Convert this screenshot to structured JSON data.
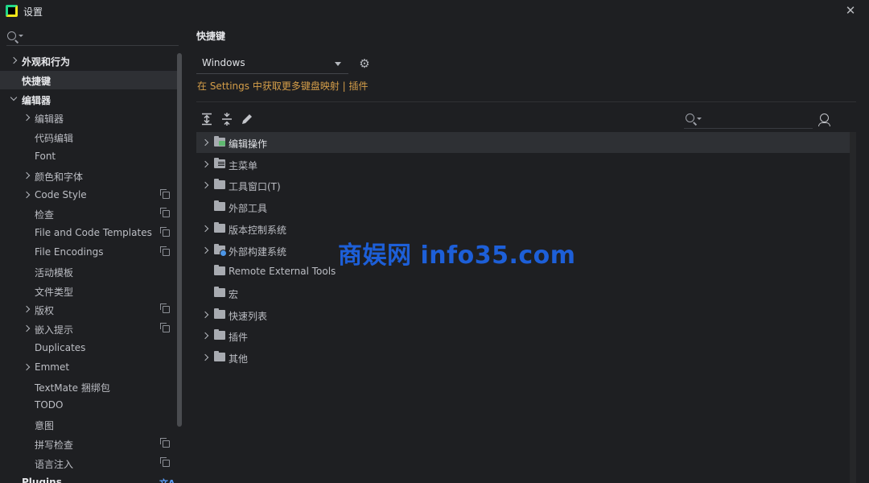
{
  "window": {
    "title": "设置",
    "close_symbol": "✕"
  },
  "sidebar": {
    "search_placeholder": "",
    "items": [
      {
        "label": "外观和行为",
        "level": 0,
        "chevron": "right"
      },
      {
        "label": "快捷键",
        "level": 0,
        "selected": true
      },
      {
        "label": "编辑器",
        "level": 0,
        "chevron": "down"
      },
      {
        "label": "编辑器",
        "level": 1,
        "chevron": "right"
      },
      {
        "label": "代码编辑",
        "level": 1
      },
      {
        "label": "Font",
        "level": 1
      },
      {
        "label": "颜色和字体",
        "level": 1,
        "chevron": "right"
      },
      {
        "label": "Code Style",
        "level": 1,
        "chevron": "right",
        "icon": "copy-icon"
      },
      {
        "label": "检查",
        "level": 1,
        "icon": "copy-icon"
      },
      {
        "label": "File and Code Templates",
        "level": 1,
        "icon": "copy-icon"
      },
      {
        "label": "File Encodings",
        "level": 1,
        "icon": "copy-icon"
      },
      {
        "label": "活动模板",
        "level": 1
      },
      {
        "label": "文件类型",
        "level": 1
      },
      {
        "label": "版权",
        "level": 1,
        "chevron": "right",
        "icon": "copy-icon"
      },
      {
        "label": "嵌入提示",
        "level": 1,
        "chevron": "right",
        "icon": "copy-icon"
      },
      {
        "label": "Duplicates",
        "level": 1
      },
      {
        "label": "Emmet",
        "level": 1,
        "chevron": "right"
      },
      {
        "label": "TextMate 捆绑包",
        "level": 1
      },
      {
        "label": "TODO",
        "level": 1
      },
      {
        "label": "意图",
        "level": 1
      },
      {
        "label": "拼写检查",
        "level": 1,
        "icon": "copy-icon"
      },
      {
        "label": "语言注入",
        "level": 1,
        "icon": "copy-icon"
      },
      {
        "label": "Plugins",
        "level": 0,
        "icon": "translate-icon"
      }
    ]
  },
  "main": {
    "title": "快捷键",
    "keymap": {
      "selected": "Windows"
    },
    "plugin_link": "在 Settings 中获取更多键盘映射 | 插件",
    "action_search_placeholder": "",
    "actions": [
      {
        "label": "编辑操作",
        "chevron": true,
        "icon": "edit-folder-icon",
        "selected": true
      },
      {
        "label": "主菜单",
        "chevron": true,
        "icon": "menu-folder-icon"
      },
      {
        "label": "工具窗口(T)",
        "chevron": true,
        "icon": "folder-icon"
      },
      {
        "label": "外部工具",
        "chevron": false,
        "icon": "folder-icon"
      },
      {
        "label": "版本控制系统",
        "chevron": true,
        "icon": "folder-icon"
      },
      {
        "label": "外部构建系统",
        "chevron": true,
        "icon": "gear-folder-icon"
      },
      {
        "label": "Remote External Tools",
        "chevron": false,
        "icon": "folder-icon"
      },
      {
        "label": "宏",
        "chevron": false,
        "icon": "folder-icon"
      },
      {
        "label": "快速列表",
        "chevron": true,
        "icon": "folder-icon"
      },
      {
        "label": "插件",
        "chevron": true,
        "icon": "folder-icon"
      },
      {
        "label": "其他",
        "chevron": true,
        "icon": "other-folder-icon"
      }
    ]
  },
  "watermark": "商娱网 info35.com",
  "colors": {
    "background": "#1e1f22",
    "selection": "#2e3034",
    "link": "#d59e49",
    "watermark": "#1d5fd8"
  }
}
